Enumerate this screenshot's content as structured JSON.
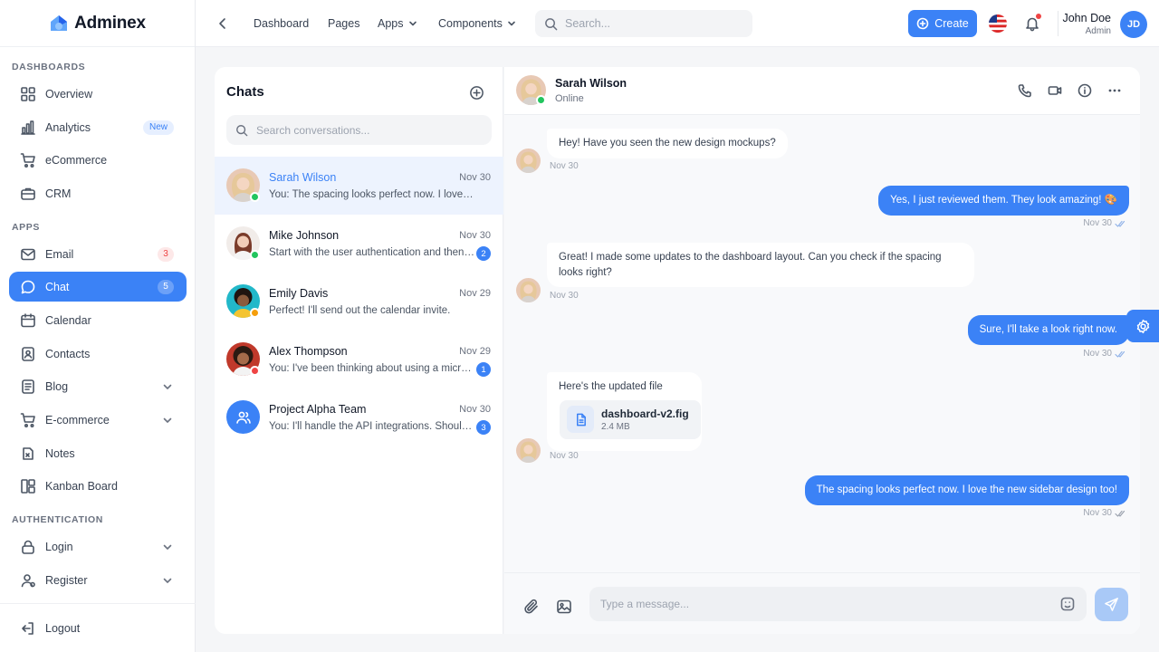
{
  "brand": {
    "name": "Adminex"
  },
  "sidebar": {
    "sections": [
      "DASHBOARDS",
      "APPS",
      "AUTHENTICATION"
    ],
    "items": [
      {
        "label": "Overview",
        "icon": "grid-icon"
      },
      {
        "label": "Analytics",
        "icon": "bar-chart-icon",
        "badge": "New"
      },
      {
        "label": "eCommerce",
        "icon": "cart-icon"
      },
      {
        "label": "CRM",
        "icon": "briefcase-icon"
      },
      {
        "label": "Email",
        "icon": "mail-icon",
        "badge": "3"
      },
      {
        "label": "Chat",
        "icon": "chat-bubble-icon",
        "badge": "5"
      },
      {
        "label": "Calendar",
        "icon": "calendar-icon"
      },
      {
        "label": "Contacts",
        "icon": "contacts-icon"
      },
      {
        "label": "Blog",
        "icon": "document-icon"
      },
      {
        "label": "E-commerce",
        "icon": "cart-icon"
      },
      {
        "label": "Notes",
        "icon": "notes-icon"
      },
      {
        "label": "Kanban Board",
        "icon": "kanban-icon"
      },
      {
        "label": "Login",
        "icon": "lock-icon"
      },
      {
        "label": "Register",
        "icon": "user-plus-icon"
      }
    ],
    "logout": "Logout"
  },
  "topbar": {
    "nav": [
      "Dashboard",
      "Pages",
      "Apps",
      "Components"
    ],
    "search_placeholder": "Search...",
    "create_label": "Create",
    "user_name": "John Doe",
    "user_role": "Admin",
    "user_initials": "JD"
  },
  "chat_list": {
    "title": "Chats",
    "search_placeholder": "Search conversations...",
    "conversations": [
      {
        "name": "Sarah Wilson",
        "date": "Nov 30",
        "preview": "You: The spacing looks perfect now. I love the new sidebar design too!",
        "status": "#22c55e"
      },
      {
        "name": "Mike Johnson",
        "date": "Nov 30",
        "preview": "Start with the user authentication and then move to the dashboard",
        "unread": "2",
        "status": "#22c55e"
      },
      {
        "name": "Emily Davis",
        "date": "Nov 29",
        "preview": "Perfect! I'll send out the calendar invite.",
        "status": "#f59e0b"
      },
      {
        "name": "Alex Thompson",
        "date": "Nov 29",
        "preview": "You: I've been thinking about using a microservices approach",
        "unread": "1",
        "status": "#ef4444"
      },
      {
        "name": "Project Alpha Team",
        "date": "Nov 30",
        "preview": "You: I'll handle the API integrations. Should be done by Friday.",
        "unread": "3"
      }
    ]
  },
  "conversation": {
    "name": "Sarah Wilson",
    "status": "Online",
    "messages": [
      {
        "text": "Hey! Have you seen the new design mockups?",
        "time": "Nov 30"
      },
      {
        "text": "Yes, I just reviewed them. They look amazing! 🎨",
        "time": "Nov 30"
      },
      {
        "text": "Great! I made some updates to the dashboard layout. Can you check if the spacing looks right?",
        "time": "Nov 30"
      },
      {
        "text": "Sure, I'll take a look right now.",
        "time": "Nov 30"
      },
      {
        "text": "Here's the updated file",
        "time": "Nov 30",
        "file_name": "dashboard-v2.fig",
        "file_size": "2.4 MB"
      },
      {
        "text": "The spacing looks perfect now. I love the new sidebar design too!",
        "time": "Nov 30"
      }
    ],
    "composer_placeholder": "Type a message..."
  },
  "colors": {
    "accent": "#3b82f6",
    "online": "#22c55e",
    "away": "#f59e0b",
    "busy": "#ef4444"
  }
}
